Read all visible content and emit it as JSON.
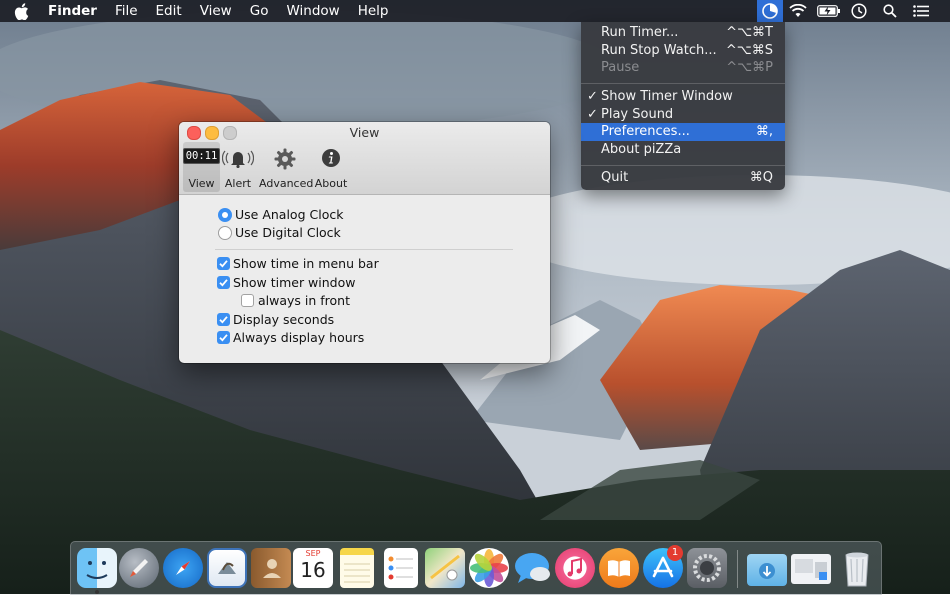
{
  "menubar": {
    "app_name": "Finder",
    "menus": [
      "File",
      "Edit",
      "View",
      "Go",
      "Window",
      "Help"
    ],
    "status_icons": [
      "pizza-timer-icon",
      "wifi-icon",
      "battery-icon",
      "time-machine-icon",
      "spotlight-search-icon",
      "notification-center-icon"
    ]
  },
  "dropdown": {
    "items": [
      {
        "label": "Run Timer...",
        "shortcut": "^⌥⌘T",
        "checked": false,
        "enabled": true
      },
      {
        "label": "Run Stop Watch...",
        "shortcut": "^⌥⌘S",
        "checked": false,
        "enabled": true
      },
      {
        "label": "Pause",
        "shortcut": "^⌥⌘P",
        "checked": false,
        "enabled": false
      },
      {
        "label": "Show Timer Window",
        "shortcut": "",
        "checked": true,
        "enabled": true
      },
      {
        "label": "Play Sound",
        "shortcut": "",
        "checked": true,
        "enabled": true
      },
      {
        "label": "Preferences...",
        "shortcut": "⌘,",
        "checked": false,
        "enabled": true,
        "highlighted": true
      },
      {
        "label": "About piZZa",
        "shortcut": "",
        "checked": false,
        "enabled": true
      },
      {
        "label": "Quit",
        "shortcut": "⌘Q",
        "checked": false,
        "enabled": true
      }
    ],
    "checkmark": "✓"
  },
  "preferences": {
    "title": "View",
    "toolbar": [
      {
        "label": "View",
        "icon": "clock-display-icon",
        "icon_text": "00:11",
        "selected": true
      },
      {
        "label": "Alert",
        "icon": "bell-icon",
        "selected": false
      },
      {
        "label": "Advanced",
        "icon": "gear-icon",
        "selected": false
      },
      {
        "label": "About",
        "icon": "info-icon",
        "selected": false
      }
    ],
    "clock_style": {
      "analog_label": "Use Analog Clock",
      "digital_label": "Use Digital Clock",
      "selected": "analog"
    },
    "options": [
      {
        "label": "Show time in menu bar",
        "checked": true
      },
      {
        "label": "Show timer window",
        "checked": true
      },
      {
        "label": "always in front",
        "checked": false
      },
      {
        "label": "Display seconds",
        "checked": true
      },
      {
        "label": "Always display hours",
        "checked": true
      }
    ]
  },
  "dock": {
    "apps": [
      "finder-icon",
      "launchpad-icon",
      "safari-icon",
      "mail-icon",
      "contacts-icon",
      "calendar-icon",
      "notes-icon",
      "reminders-icon",
      "maps-icon",
      "photos-icon",
      "messages-icon",
      "itunes-icon",
      "ibooks-icon",
      "app-store-icon",
      "system-preferences-icon",
      "downloads-icon",
      "documents-icon",
      "trash-icon"
    ],
    "calendar": {
      "month": "SEP",
      "day": "16"
    },
    "app_store_badge": "1"
  },
  "colors": {
    "menubar_bg": "#1c1e26",
    "menu_highlight": "#2f6fd6",
    "control_accent": "#3a8ff2",
    "close": "#fc605b",
    "minimize": "#fdbc40",
    "zoom_disabled": "#cdcdcd"
  }
}
